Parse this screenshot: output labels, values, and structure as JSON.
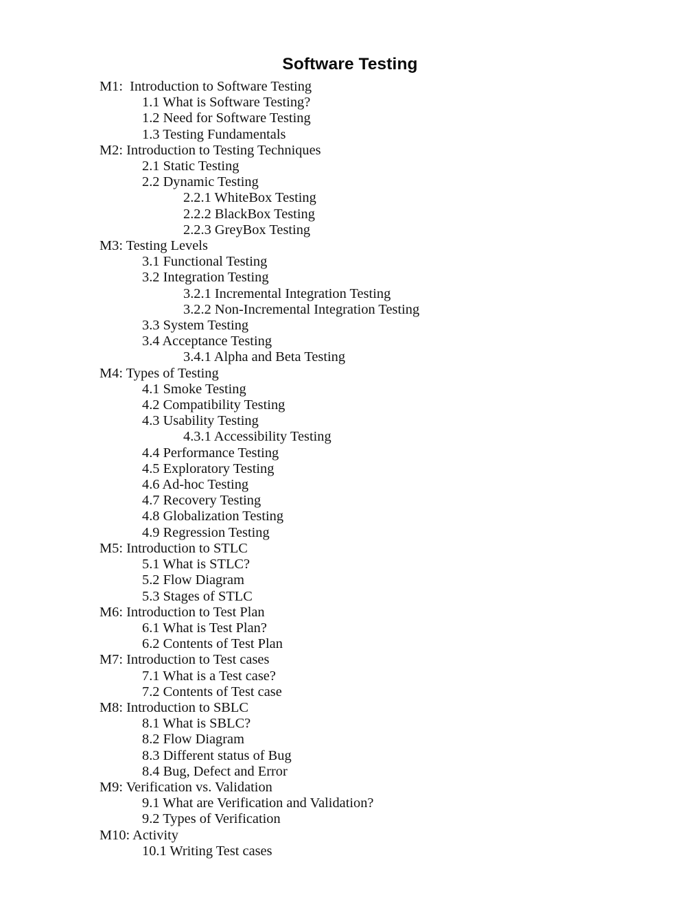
{
  "document": {
    "title": "Software Testing",
    "outline": [
      {
        "level": 0,
        "text": "M1:  Introduction to Software Testing"
      },
      {
        "level": 1,
        "text": "1.1 What is Software Testing?"
      },
      {
        "level": 1,
        "text": "1.2 Need for Software Testing"
      },
      {
        "level": 1,
        "text": "1.3 Testing Fundamentals"
      },
      {
        "level": 0,
        "text": "M2: Introduction to Testing Techniques"
      },
      {
        "level": 1,
        "text": "2.1 Static Testing"
      },
      {
        "level": 1,
        "text": "2.2 Dynamic Testing"
      },
      {
        "level": 2,
        "text": "2.2.1 WhiteBox Testing"
      },
      {
        "level": 2,
        "text": "2.2.2 BlackBox Testing"
      },
      {
        "level": 2,
        "text": "2.2.3 GreyBox Testing"
      },
      {
        "level": 0,
        "text": "M3: Testing Levels"
      },
      {
        "level": 1,
        "text": "3.1 Functional Testing"
      },
      {
        "level": 1,
        "text": "3.2 Integration Testing"
      },
      {
        "level": 2,
        "text": "3.2.1 Incremental Integration Testing"
      },
      {
        "level": 2,
        "text": "3.2.2 Non-Incremental Integration Testing"
      },
      {
        "level": 1,
        "text": "3.3 System Testing"
      },
      {
        "level": 1,
        "text": "3.4 Acceptance Testing"
      },
      {
        "level": 2,
        "text": "3.4.1 Alpha and Beta Testing"
      },
      {
        "level": 0,
        "text": "M4: Types of Testing"
      },
      {
        "level": 1,
        "text": "4.1 Smoke Testing"
      },
      {
        "level": 1,
        "text": "4.2 Compatibility Testing"
      },
      {
        "level": 1,
        "text": "4.3 Usability Testing"
      },
      {
        "level": 2,
        "text": "4.3.1 Accessibility Testing"
      },
      {
        "level": 1,
        "text": "4.4 Performance Testing"
      },
      {
        "level": 1,
        "text": "4.5 Exploratory Testing"
      },
      {
        "level": 1,
        "text": "4.6 Ad-hoc Testing"
      },
      {
        "level": 1,
        "text": "4.7 Recovery Testing"
      },
      {
        "level": 1,
        "text": "4.8 Globalization Testing"
      },
      {
        "level": 1,
        "text": "4.9 Regression Testing"
      },
      {
        "level": 0,
        "text": "M5: Introduction to STLC"
      },
      {
        "level": 1,
        "text": "5.1 What is STLC?"
      },
      {
        "level": 1,
        "text": "5.2 Flow Diagram"
      },
      {
        "level": 1,
        "text": "5.3 Stages of STLC"
      },
      {
        "level": 0,
        "text": "M6: Introduction to Test Plan"
      },
      {
        "level": 1,
        "text": "6.1 What is Test Plan?"
      },
      {
        "level": 1,
        "text": "6.2 Contents of Test Plan"
      },
      {
        "level": 0,
        "text": "M7: Introduction to Test cases"
      },
      {
        "level": 1,
        "text": "7.1 What is a Test case?"
      },
      {
        "level": 1,
        "text": "7.2 Contents of Test case"
      },
      {
        "level": 0,
        "text": "M8: Introduction to SBLC"
      },
      {
        "level": 1,
        "text": "8.1 What is SBLC?"
      },
      {
        "level": 1,
        "text": "8.2 Flow Diagram"
      },
      {
        "level": 1,
        "text": "8.3 Different status of Bug"
      },
      {
        "level": 1,
        "text": "8.4 Bug, Defect and Error"
      },
      {
        "level": 0,
        "text": "M9: Verification vs. Validation"
      },
      {
        "level": 1,
        "text": "9.1 What are Verification and Validation?"
      },
      {
        "level": 1,
        "text": "9.2 Types of Verification"
      },
      {
        "level": 0,
        "text": "M10: Activity"
      },
      {
        "level": 1,
        "text": "10.1 Writing Test cases"
      }
    ]
  }
}
